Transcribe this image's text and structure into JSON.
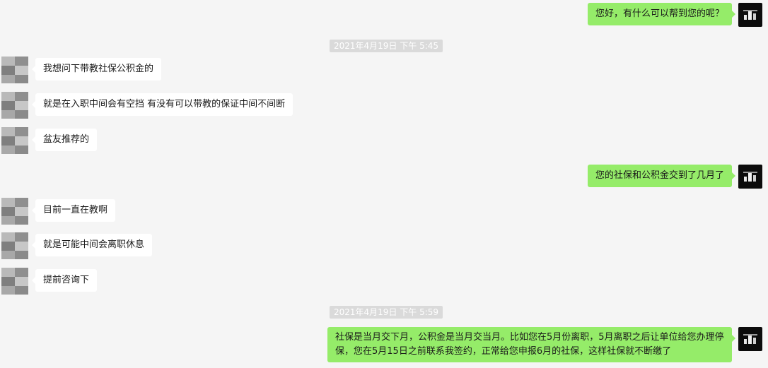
{
  "timestamps": [
    "2021年4月19日 下午 5:45",
    "2021年4月19日 下午 5:59"
  ],
  "messages": [
    {
      "side": "agent",
      "text": "您好，有什么可以帮到您的呢？"
    },
    {
      "side": "user",
      "text": "我想问下带教社保公积金的"
    },
    {
      "side": "user",
      "text": "就是在入职中间会有空挡 有没有可以带教的保证中间不间断"
    },
    {
      "side": "user",
      "text": "盆友推荐的"
    },
    {
      "side": "agent",
      "text": "您的社保和公积金交到了几月了"
    },
    {
      "side": "user",
      "text": "目前一直在教啊"
    },
    {
      "side": "user",
      "text": "就是可能中间会离职休息"
    },
    {
      "side": "user",
      "text": "提前咨询下"
    },
    {
      "side": "agent",
      "text": "社保是当月交下月，公积金是当月交当月。比如您在5月份离职，5月离职之后让单位给您办理停保，您在5月15日之前联系我签约，正常给您申报6月的社保，这样社保就不断缴了"
    }
  ],
  "colors": {
    "agent_bubble": "#95ec69",
    "user_bubble": "#ffffff",
    "background": "#f5f5f5"
  }
}
